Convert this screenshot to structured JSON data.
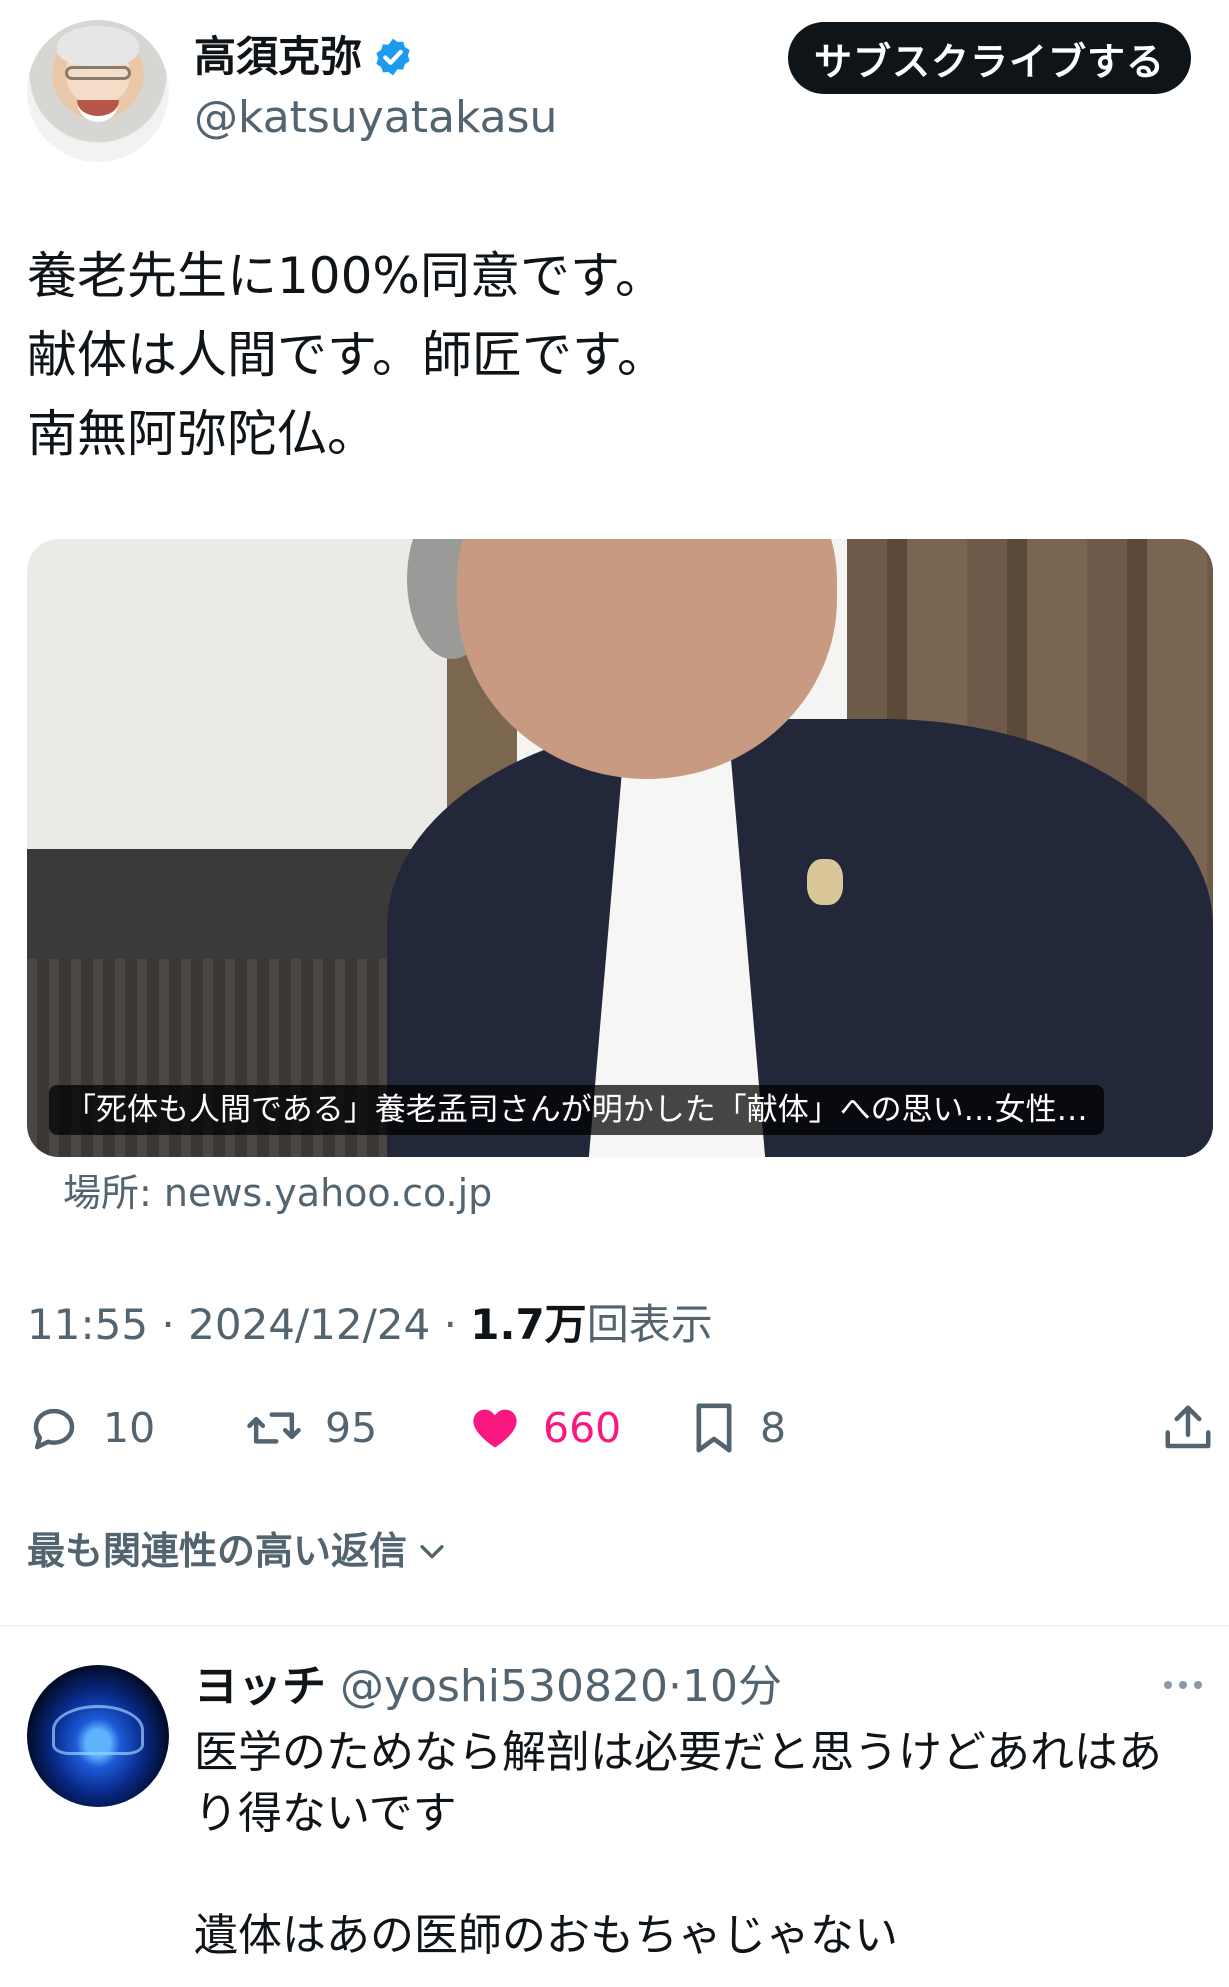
{
  "tweet": {
    "author_name": "高須克弥",
    "author_handle": "@katsuyatakasu",
    "subscribe_label": "サブスクライブする",
    "text_lines": [
      "養老先生に100%同意です。",
      "献体は人間です。師匠です。",
      "南無阿弥陀仏。"
    ],
    "card": {
      "caption": "「死体も人間である」養老孟司さんが明かした「献体」への思い…女性…",
      "source": "場所: news.yahoo.co.jp"
    },
    "time": "11:55",
    "date": "2024/12/24",
    "separator": "·",
    "views_count": "1.7万",
    "views_label": "回表示"
  },
  "actions": {
    "replies": "10",
    "retweets": "95",
    "likes": "660",
    "bookmarks": "8"
  },
  "replies_filter": {
    "label": "最も関連性の高い返信"
  },
  "reply": {
    "name": "ヨッチ",
    "handle": "@yoshi530820",
    "separator": "·",
    "time": "10分",
    "text_lines": [
      "医学のためなら解剖は必要だと思うけどあれはあ",
      "り得ないです",
      "",
      "遺体はあの医師のおもちゃじゃない"
    ]
  },
  "colors": {
    "like": "#f91880",
    "verified": "#1d9bf0",
    "muted_text": "#536471",
    "primary_text": "#0f1419"
  },
  "icons": [
    "verified-badge-icon",
    "reply-icon",
    "retweet-icon",
    "like-heart-icon",
    "bookmark-icon",
    "share-icon",
    "chevron-down-icon",
    "more-options-icon"
  ]
}
